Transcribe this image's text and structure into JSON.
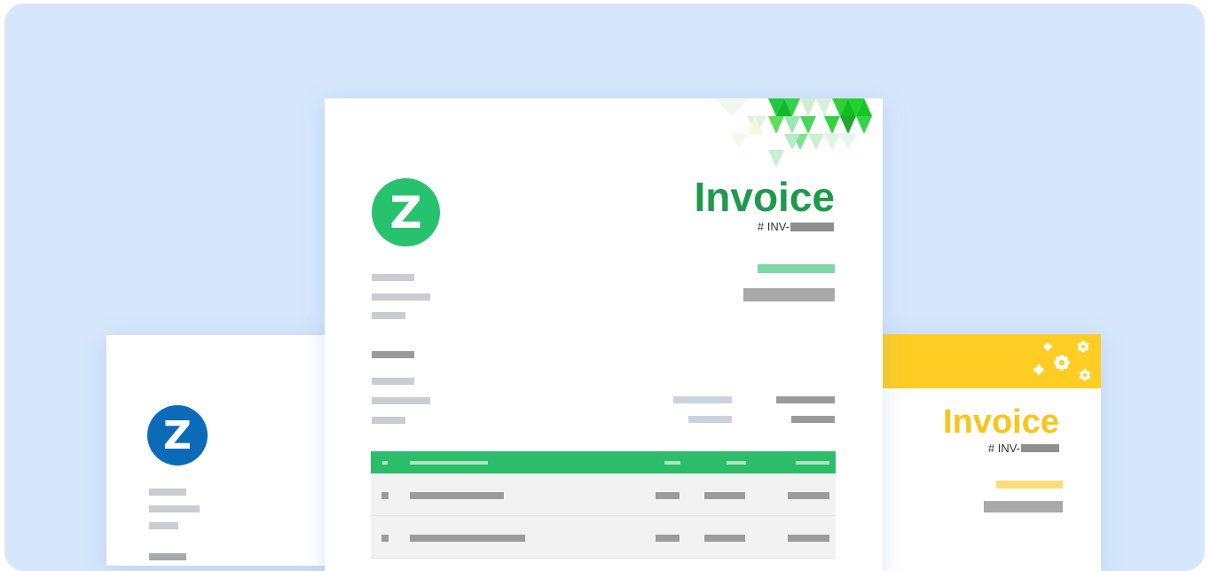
{
  "colors": {
    "background": "#d6e7fd",
    "card": "#ffffff",
    "green_accent": "#27c26d",
    "green_title": "#1f9a4d",
    "blue_logo": "#0c6bb9",
    "yellow_accent": "#ffcd23",
    "placeholder_bar": "#9a9a9a"
  },
  "templates": {
    "center": {
      "logo_letter": "Z",
      "title": "Invoice",
      "number_prefix": "# INV-",
      "decoration": "green-triangle-pattern-icon"
    },
    "left": {
      "logo_letter": "Z"
    },
    "right": {
      "title": "Invoice",
      "number_prefix": "# INV-",
      "decoration": "yellow-flower-pattern-icon"
    }
  }
}
